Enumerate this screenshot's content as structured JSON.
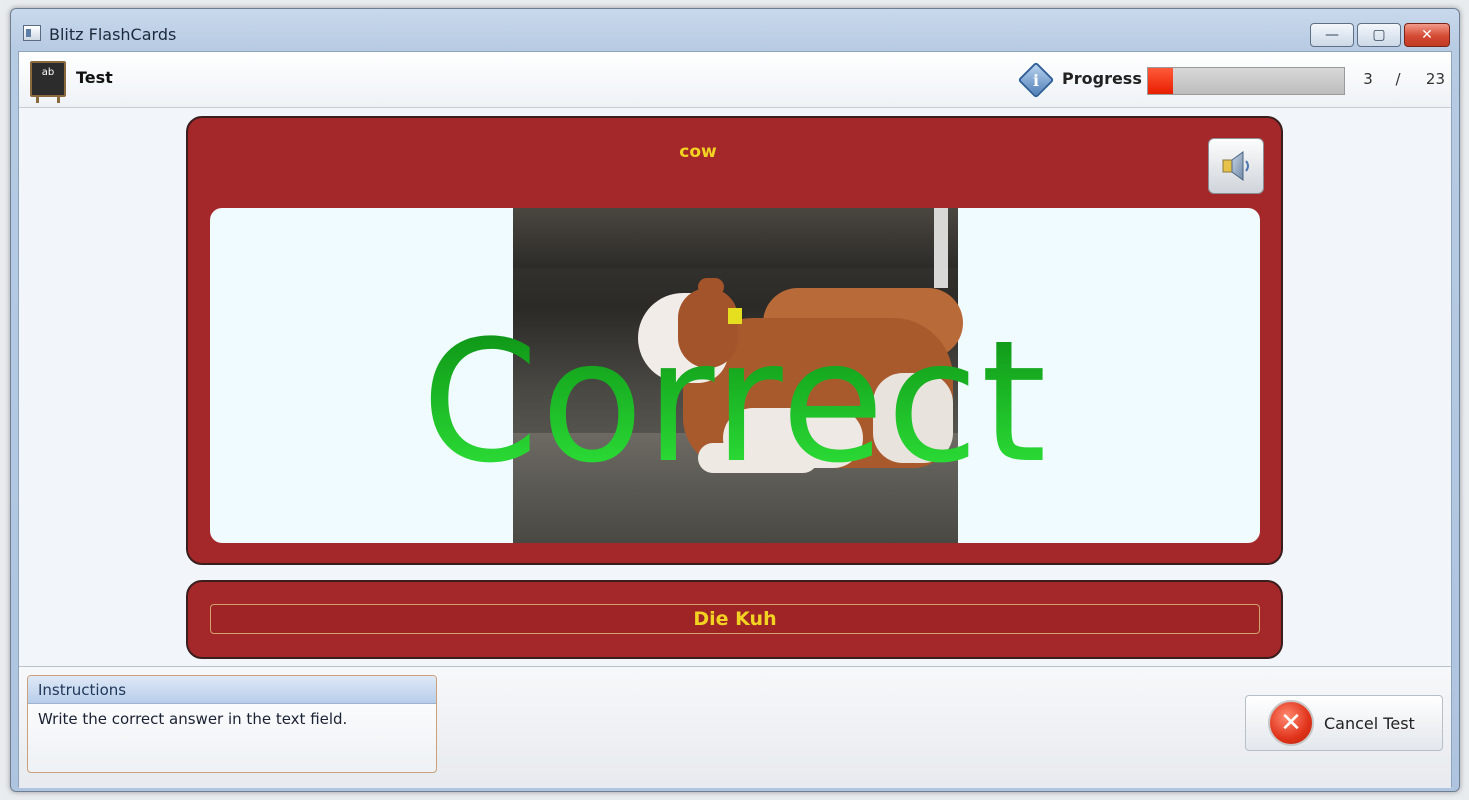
{
  "window": {
    "title": "Blitz FlashCards",
    "controls": {
      "minimize": "—",
      "maximize": "▢",
      "close": "✕"
    }
  },
  "toolbar": {
    "mode_icon_text": "ab",
    "mode_label": "Test",
    "progress_label": "Progress",
    "progress_current": "3",
    "progress_separator": "/",
    "progress_total": "23",
    "progress_fraction": 0.13,
    "progress_color": "#e81e00"
  },
  "card": {
    "word": "cow",
    "feedback": "Correct",
    "card_color": "#a4282a",
    "word_color": "#f2d321",
    "feedback_color": "#17c21d"
  },
  "answer": {
    "value": "Die Kuh"
  },
  "instructions": {
    "title": "Instructions",
    "text": "Write the correct answer in the text field."
  },
  "actions": {
    "cancel_label": "Cancel Test",
    "cancel_icon": "x-icon"
  }
}
